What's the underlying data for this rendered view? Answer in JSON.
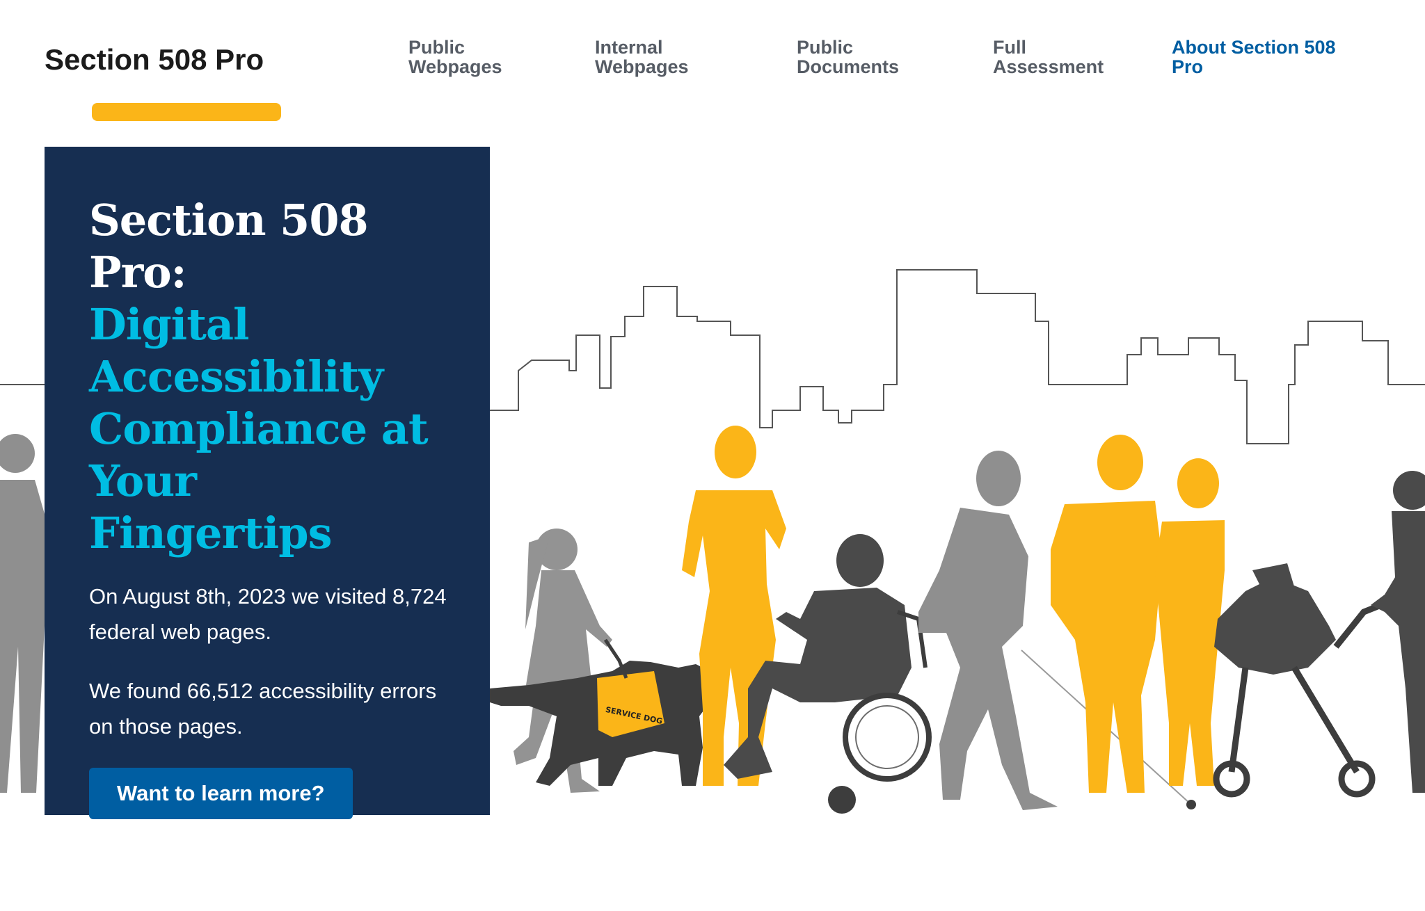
{
  "header": {
    "site_title": "Section 508 Pro",
    "nav": [
      {
        "label": "Public\nWebpages",
        "current": false
      },
      {
        "label": "Internal\nWebpages",
        "current": false
      },
      {
        "label": "Public\nDocuments",
        "current": false
      },
      {
        "label": "Full\nAssessment",
        "current": false
      },
      {
        "label": "About Section 508\nPro",
        "current": true
      }
    ]
  },
  "hero": {
    "heading_line": "Section 508 Pro:",
    "heading_accent": "Digital Accessibility Compliance at Your Fingertips",
    "paragraph_1": "On August 8th, 2023 we visited 8,724 federal web pages.",
    "paragraph_2": "We found 66,512 accessibility errors on those pages.",
    "cta_label": "Want to learn more?"
  },
  "colors": {
    "card_background": "#162e51",
    "heading_accent": "#00bde3",
    "button": "#005ea2",
    "brand_yellow": "#fbb518",
    "nav_text": "#565c65",
    "nav_current": "#005ea2",
    "figure_gray": "#8c8c8c",
    "figure_dark": "#4a4a4a"
  }
}
